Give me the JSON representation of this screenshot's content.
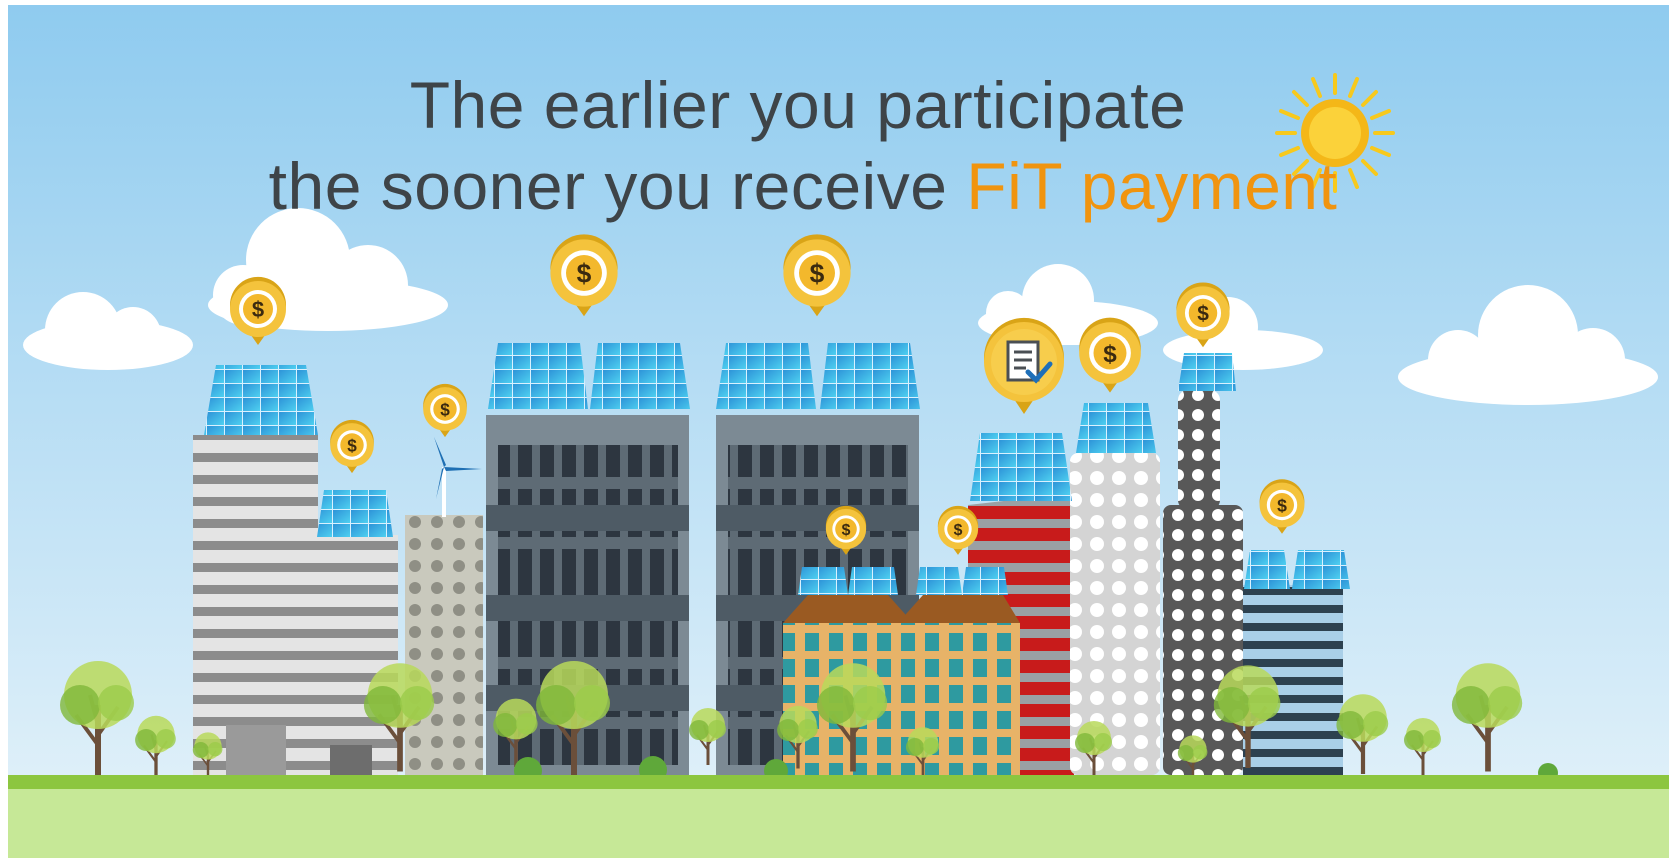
{
  "headline": {
    "line1": "The earlier you participate",
    "line2_prefix": "the sooner you receive ",
    "line2_accent": "FiT payment"
  },
  "coin_symbol": "$",
  "colors": {
    "sky_top": "#8fcbef",
    "sky_bottom": "#e6f3fa",
    "accent": "#f0940f",
    "text": "#3e4448",
    "coin": "#f4c33c",
    "grass": "#8cc63f",
    "sun": "#f7c91d"
  },
  "icons": [
    "sun-icon",
    "coin-icon",
    "document-check-icon",
    "wind-turbine-icon",
    "solar-panel-icon",
    "tree-icon",
    "cloud-icon"
  ]
}
